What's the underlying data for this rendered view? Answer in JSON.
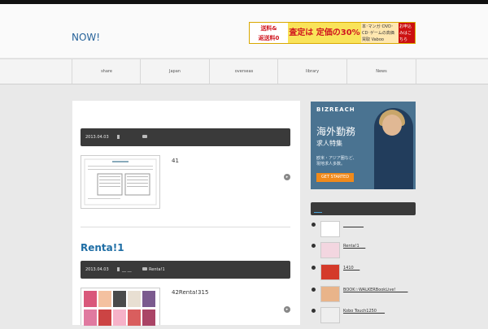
{
  "header": {
    "site_title": "NOW!",
    "banner": {
      "left": "送料&\n返送料0",
      "middle": "査定は 定価の30%以上",
      "right_small": "本･マンガ･DVD･CD･ゲームの高価買取 Vaboo",
      "cta": "お申込みはこちら"
    }
  },
  "nav": {
    "items": [
      "share",
      "Japan",
      "overseas",
      "library",
      "News"
    ]
  },
  "posts": [
    {
      "date": "2013.04.03",
      "category": "",
      "tag": "",
      "excerpt": "41"
    },
    {
      "title": "Renta!1",
      "date": "2013.04.03",
      "category": "__ __",
      "tag": "Renta!1",
      "excerpt": "42Renta!315"
    }
  ],
  "sidebar": {
    "ad": {
      "brand": "BIZREACH",
      "headline": "海外勤務",
      "subheadline": "求人特集",
      "body": "欧米・アジア圏など、\n現地求人多数。",
      "cta": "GET STARTED"
    },
    "widget_title": "",
    "items": [
      {
        "label": "__________"
      },
      {
        "label": "Renta!1___"
      },
      {
        "label": "1410___"
      },
      {
        "label": "BOOK☆WALKERBookLive!______"
      },
      {
        "label": "Kobo Touch1250____"
      }
    ]
  },
  "colors": {
    "accent_blue": "#1f6ea5",
    "meta_bar": "#3a3a3a",
    "background": "#e9e9e9"
  }
}
